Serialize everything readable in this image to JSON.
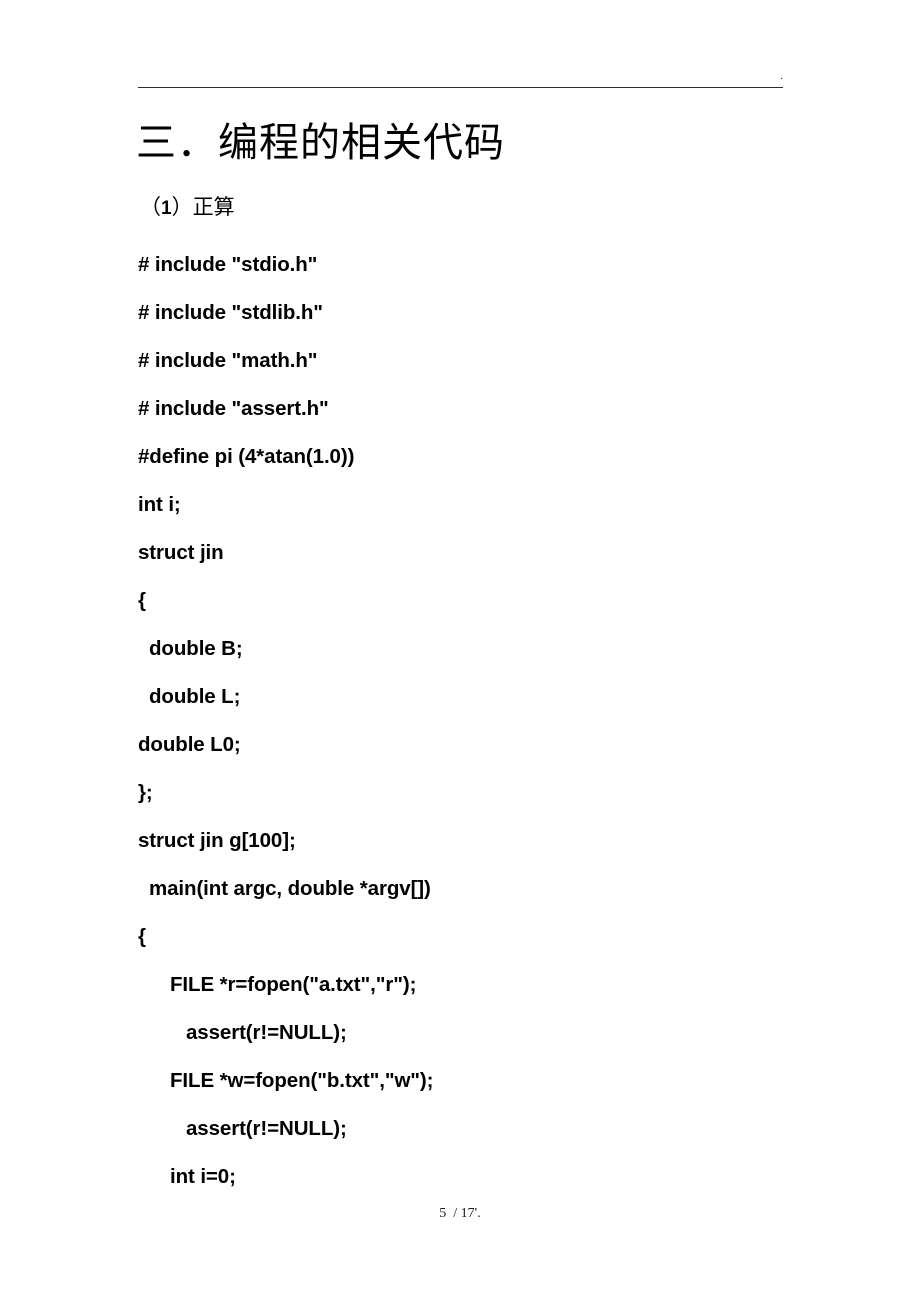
{
  "header": {
    "rule_mark": "."
  },
  "headings": {
    "section_title": "三．编程的相关代码",
    "subsection_prefix": "（",
    "subsection_number": "1",
    "subsection_suffix": "）正算"
  },
  "code": {
    "lines": [
      {
        "text": "# include \"stdio.h\"",
        "indent": 0
      },
      {
        "text": "# include \"stdlib.h\"",
        "indent": 0
      },
      {
        "text": "# include \"math.h\"",
        "indent": 0
      },
      {
        "text": "# include \"assert.h\"",
        "indent": 0
      },
      {
        "text": "#define pi (4*atan(1.0))",
        "indent": 0
      },
      {
        "text": "int i;",
        "indent": 0
      },
      {
        "text": "struct jin",
        "indent": 0
      },
      {
        "text": "{",
        "indent": 0
      },
      {
        "text": "double B;",
        "indent": 1
      },
      {
        "text": "double L;",
        "indent": 1
      },
      {
        "text": "double L0;",
        "indent": 0
      },
      {
        "text": "};",
        "indent": 0
      },
      {
        "text": "struct jin g[100];",
        "indent": 0
      },
      {
        "text": "main(int argc, double *argv[])",
        "indent": 1
      },
      {
        "text": "{",
        "indent": 0
      },
      {
        "text": "FILE *r=fopen(\"a.txt\",\"r\");",
        "indent": 2
      },
      {
        "text": "assert(r!=NULL);",
        "indent": 3
      },
      {
        "text": "FILE *w=fopen(\"b.txt\",\"w\");",
        "indent": 2
      },
      {
        "text": "assert(r!=NULL);",
        "indent": 3
      },
      {
        "text": "int i=0;",
        "indent": 2
      }
    ]
  },
  "footer": {
    "page_label": "5  / 17'."
  }
}
